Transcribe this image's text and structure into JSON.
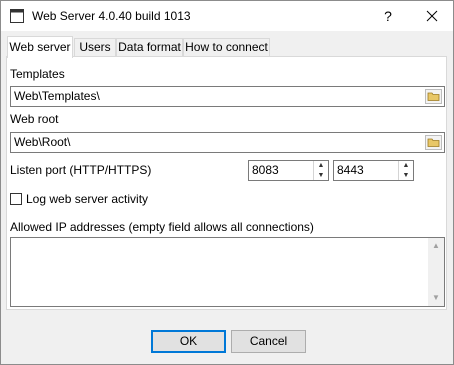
{
  "window": {
    "title": "Web Server 4.0.40 build 1013",
    "help_label": "?",
    "close_icon": "close-icon"
  },
  "tabs": [
    {
      "label": "Web server",
      "active": true
    },
    {
      "label": "Users",
      "active": false
    },
    {
      "label": "Data format",
      "active": false
    },
    {
      "label": "How to connect",
      "active": false
    }
  ],
  "form": {
    "templates_label": "Templates",
    "templates_value": "Web\\Templates\\",
    "webroot_label": "Web root",
    "webroot_value": "Web\\Root\\",
    "listen_port_label": "Listen port (HTTP/HTTPS)",
    "http_port": "8083",
    "https_port": "8443",
    "log_label": "Log web server activity",
    "log_checked": false,
    "allowed_ip_label": "Allowed IP addresses (empty field allows all connections)",
    "allowed_ip_value": ""
  },
  "buttons": {
    "ok_label": "OK",
    "cancel_label": "Cancel"
  },
  "colors": {
    "accent": "#0078d7",
    "folder": "#e8c767"
  }
}
